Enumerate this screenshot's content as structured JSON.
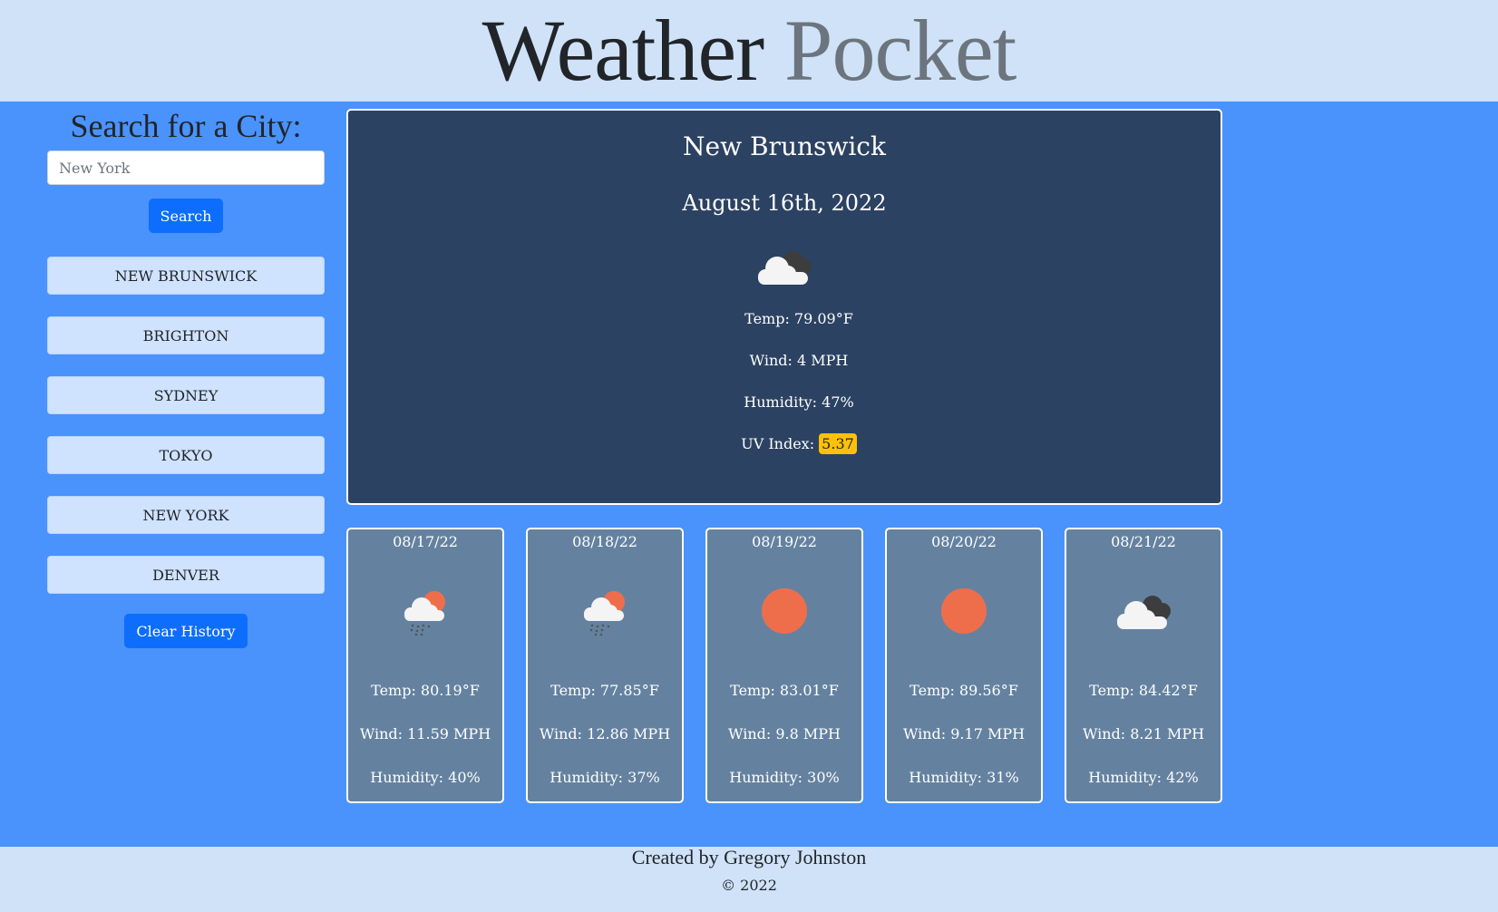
{
  "header": {
    "title_part1": "Weather",
    "title_part2": "Pocket"
  },
  "sidebar": {
    "heading": "Search for a City:",
    "search_placeholder": "New York",
    "search_button": "Search",
    "history": [
      "NEW BRUNSWICK",
      "BRIGHTON",
      "SYDNEY",
      "TOKYO",
      "NEW YORK",
      "DENVER"
    ],
    "clear_button": "Clear History"
  },
  "current": {
    "city": "New Brunswick",
    "date": "August 16th, 2022",
    "icon": "cloudy-icon",
    "temp": "Temp: 79.09°F",
    "wind": "Wind: 4 MPH",
    "humidity": "Humidity: 47%",
    "uv_label": "UV Index:",
    "uv_value": "5.37"
  },
  "forecast": [
    {
      "date": "08/17/22",
      "icon": "rain-sun-icon",
      "temp": "Temp: 80.19°F",
      "wind": "Wind: 11.59 MPH",
      "humidity": "Humidity: 40%"
    },
    {
      "date": "08/18/22",
      "icon": "rain-sun-icon",
      "temp": "Temp: 77.85°F",
      "wind": "Wind: 12.86 MPH",
      "humidity": "Humidity: 37%"
    },
    {
      "date": "08/19/22",
      "icon": "sun-icon",
      "temp": "Temp: 83.01°F",
      "wind": "Wind: 9.8 MPH",
      "humidity": "Humidity: 30%"
    },
    {
      "date": "08/20/22",
      "icon": "sun-icon",
      "temp": "Temp: 89.56°F",
      "wind": "Wind: 9.17 MPH",
      "humidity": "Humidity: 31%"
    },
    {
      "date": "08/21/22",
      "icon": "cloudy-icon",
      "temp": "Temp: 84.42°F",
      "wind": "Wind: 8.21 MPH",
      "humidity": "Humidity: 42%"
    }
  ],
  "footer": {
    "credit": "Created by Gregory Johnston",
    "copyright": "© 2022"
  },
  "colors": {
    "header_bg": "#cfe2f8",
    "main_bg": "#4a92fc",
    "current_bg": "#2c4262",
    "card_bg": "#6482a0",
    "primary_button": "#0d6efd",
    "uv_badge": "#ffc107",
    "sun": "#ee6e4c"
  }
}
